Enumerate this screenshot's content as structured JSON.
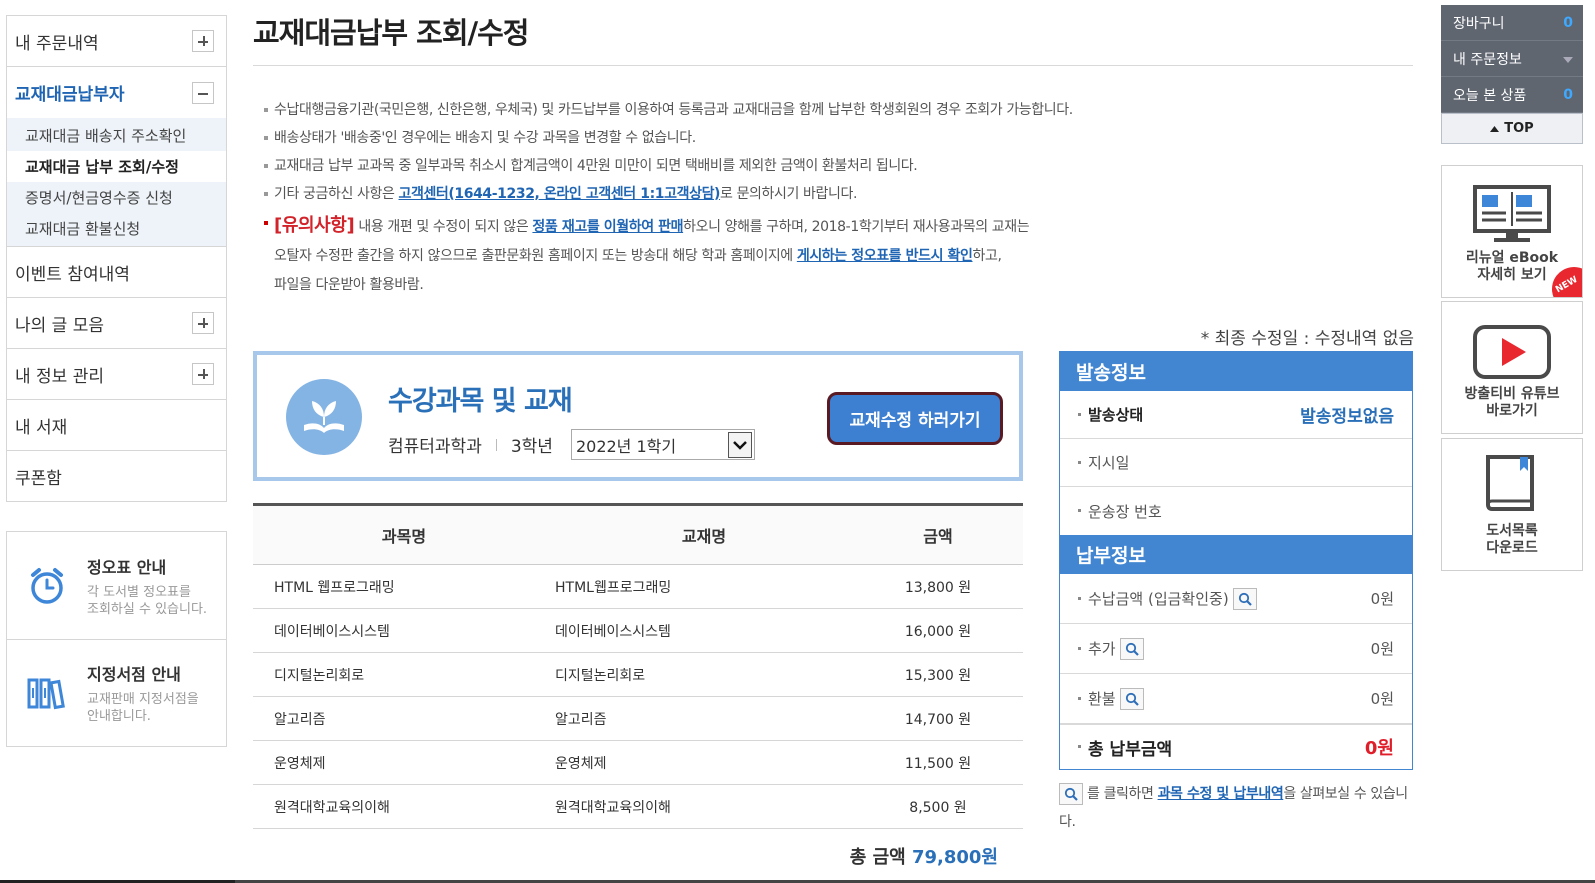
{
  "sidebar": {
    "items": [
      {
        "label": "내 주문내역"
      },
      {
        "label": "교재대금납부자"
      },
      {
        "label": "이벤트 참여내역"
      },
      {
        "label": "나의 글 모음"
      },
      {
        "label": "내 정보 관리"
      },
      {
        "label": "내 서재"
      },
      {
        "label": "쿠폰함"
      }
    ],
    "sub_items": [
      {
        "label": "교재대금 배송지 주소확인"
      },
      {
        "label": "교재대금 납부 조회/수정"
      },
      {
        "label": "증명서/현금영수증 신청"
      },
      {
        "label": "교재대금 환불신청"
      }
    ],
    "boxes": [
      {
        "title": "정오표 안내",
        "desc1": "각 도서별 정오표를",
        "desc2": "조회하실 수 있습니다."
      },
      {
        "title": "지정서점 안내",
        "desc1": "교재판매 지정서점을",
        "desc2": "안내합니다."
      }
    ]
  },
  "page": {
    "title": "교재대금납부 조회/수정",
    "notes": [
      "수납대행금융기관(국민은행, 신한은행, 우체국) 및 카드납부를 이용하여 등록금과 교재대금을 함께 납부한 학생회원의 경우 조회가 가능합니다.",
      "배송상태가 '배송중'인 경우에는 배송지 및 수강 과목을 변경할 수 없습니다.",
      "교재대금 납부 교과목 중 일부과목 취소시 합계금액이 4만원 미만이 되면 택배비를 제외한 금액이 환불처리 됩니다."
    ],
    "note4": {
      "pre": "기타 궁금하신 사항은 ",
      "link": "고객센터(1644-1232, 온라인 고객센터 1:1고객상담)",
      "post": "로 문의하시기 바랍니다."
    },
    "warning": {
      "tag": "[유의사항]",
      "t1": " 내용 개편 및 수정이 되지 않은 ",
      "link1": "정품 재고를 이월하여 판매",
      "t2": "하오니 양해를 구하며, 2018-1학기부터 재사용과목의 교재는",
      "t3": "오탈자 수정판 출간을 하지 않으므로 출판문화원 홈페이지 또는 방송대 해당 학과 홈페이지에 ",
      "link2": "게시하는 정오표를 반드시 확인",
      "t4": "하고,",
      "t5": "파일을 다운받아 활용바람."
    },
    "last_modified": "* 최종 수정일 : 수정내역 없음"
  },
  "course": {
    "title": "수강과목 및 교재",
    "dept": "컴퓨터과학과",
    "grade": "3학년",
    "semester": "2022년 1학기",
    "edit_button": "교재수정 하러가기"
  },
  "table": {
    "headers": [
      "과목명",
      "교재명",
      "금액"
    ],
    "rows": [
      {
        "subject": "HTML 웹프로그래밍",
        "book": "HTML웹프로그래밍",
        "price": "13,800 원"
      },
      {
        "subject": "데이터베이스시스템",
        "book": "데이터베이스시스템",
        "price": "16,000 원"
      },
      {
        "subject": "디지털논리회로",
        "book": "디지털논리회로",
        "price": "15,300 원"
      },
      {
        "subject": "알고리즘",
        "book": "알고리즘",
        "price": "14,700 원"
      },
      {
        "subject": "운영체제",
        "book": "운영체제",
        "price": "11,500 원"
      },
      {
        "subject": "원격대학교육의이해",
        "book": "원격대학교육의이해",
        "price": "8,500 원"
      }
    ],
    "total_label": "총 금액 ",
    "total_value": "79,800원"
  },
  "shipping": {
    "header": "발송정보",
    "status_label": "발송상태",
    "status_value": "발송정보없음",
    "date_label": "지시일",
    "tracking_label": "운송장 번호"
  },
  "payment": {
    "header": "납부정보",
    "paid_label": "수납금액 (입금확인중)",
    "paid_value": "0원",
    "extra_label": "추가",
    "extra_value": "0원",
    "refund_label": "환불",
    "refund_value": "0원",
    "total_label": "총 납부금액",
    "total_value": "0원"
  },
  "info_footer": {
    "pre": " 를 클릭하면 ",
    "link": "과목 수정 및 납부내역",
    "post": "을 살펴보실 수 있습니다."
  },
  "quick": {
    "cart_label": "장바구니",
    "cart_count": "0",
    "order_label": "내 주문정보",
    "recent_label": "오늘 본 상품",
    "recent_count": "0",
    "top_label": "TOP",
    "ebook_line1": "리뉴얼 eBook",
    "ebook_line2": "자세히 보기",
    "new_badge": "NEW",
    "youtube_line1": "방출티비 유튜브",
    "youtube_line2": "바로가기",
    "catalog_line1": "도서목록",
    "catalog_line2": "다운로드"
  },
  "colors": {
    "accent": "#4286d1",
    "link": "#1f65b4",
    "warn": "#d2232a"
  }
}
